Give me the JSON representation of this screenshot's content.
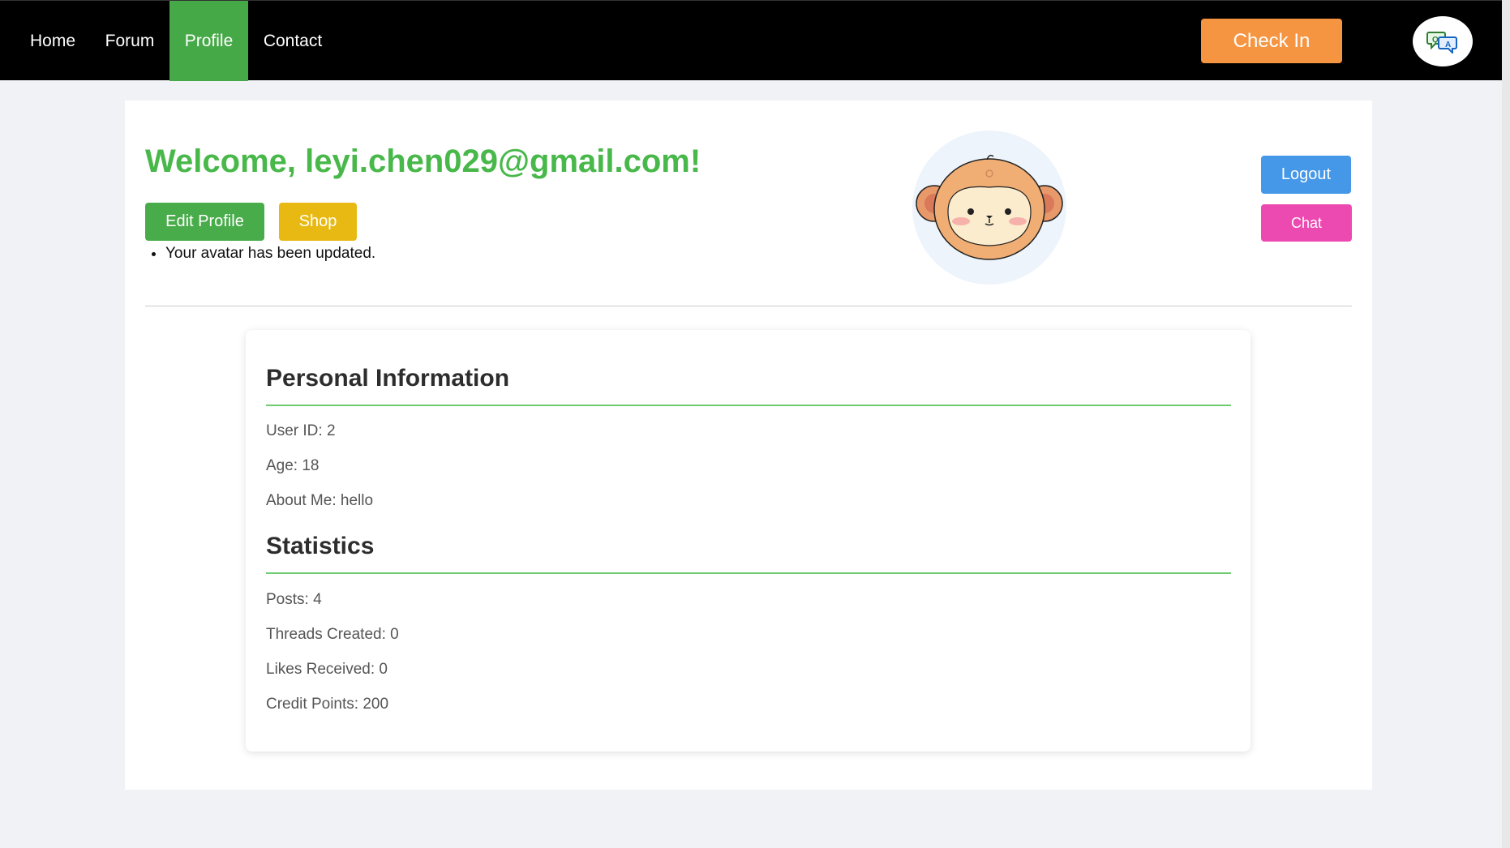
{
  "nav": {
    "items": [
      {
        "label": "Home"
      },
      {
        "label": "Forum"
      },
      {
        "label": "Profile"
      },
      {
        "label": "Contact"
      }
    ],
    "check_in_label": "Check In",
    "qa_icon": "qa-chat-icon"
  },
  "profile": {
    "welcome": "Welcome, leyi.chen029@gmail.com!",
    "edit_label": "Edit Profile",
    "shop_label": "Shop",
    "message": "Your avatar has been updated.",
    "avatar_icon": "monkey-avatar",
    "logout_label": "Logout",
    "chat_label": "Chat"
  },
  "personal": {
    "title": "Personal Information",
    "user_id": "User ID: 2",
    "age": "Age: 18",
    "about": "About Me: hello"
  },
  "stats": {
    "title": "Statistics",
    "posts": "Posts: 4",
    "threads": "Threads Created: 0",
    "likes": "Likes Received: 0",
    "credits": "Credit Points: 200"
  },
  "colors": {
    "nav_bg": "#000000",
    "active_tab": "#46a948",
    "check_in": "#f59541",
    "welcome_text": "#48b84a",
    "edit_btn": "#48ac4a",
    "shop_btn": "#e8b912",
    "logout_btn": "#4597e7",
    "chat_btn": "#ec4ab0",
    "section_rule": "#6ccc6e"
  }
}
